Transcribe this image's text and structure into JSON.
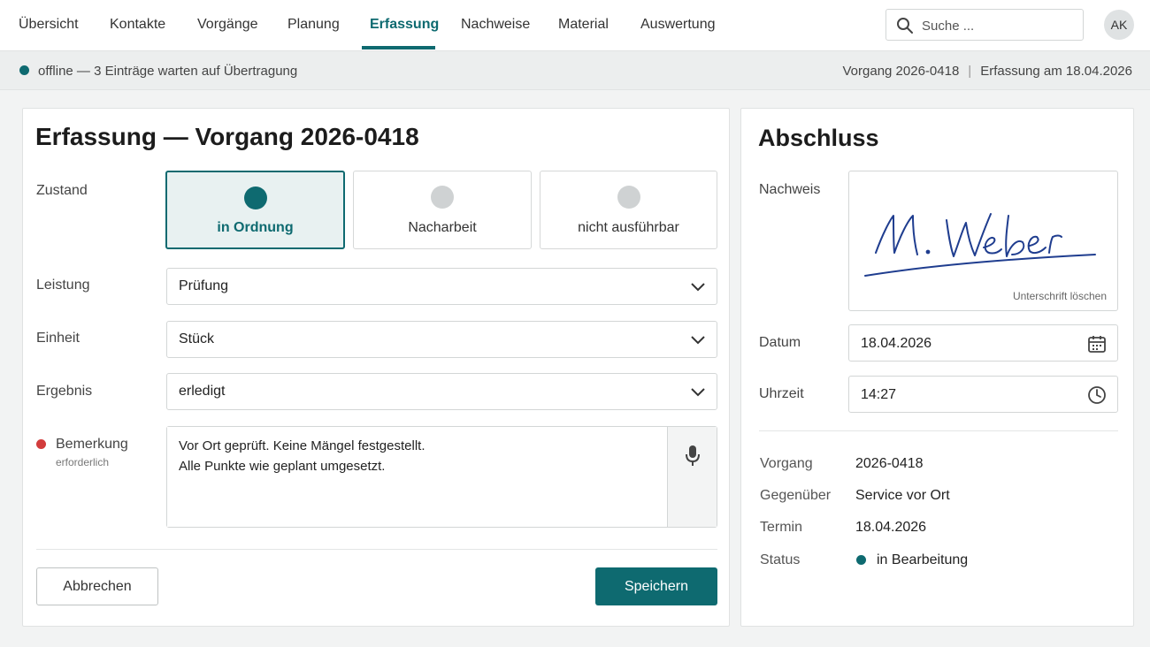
{
  "nav": {
    "tabs": [
      {
        "label": "Übersicht"
      },
      {
        "label": "Kontakte"
      },
      {
        "label": "Vorgänge"
      },
      {
        "label": "Planung"
      },
      {
        "label": "Erfassung",
        "active": true
      },
      {
        "label": "Nachweise"
      },
      {
        "label": "Material"
      },
      {
        "label": "Auswertung"
      }
    ],
    "search_placeholder": "Suche ...",
    "avatar_initials": "AK"
  },
  "status": {
    "text": "offline — 3 Einträge warten auf Übertragung",
    "vorgang": "Vorgang 2026-0418",
    "separator": "|",
    "erfassung_datum": "Erfassung am 18.04.2026",
    "dot_color": "#0e6a70"
  },
  "form": {
    "title": "Erfassung — Vorgang 2026-0418",
    "zustand_label": "Zustand",
    "zustand_options": [
      {
        "label": "in Ordnung",
        "selected": true
      },
      {
        "label": "Nacharbeit",
        "selected": false
      },
      {
        "label": "nicht ausführbar",
        "selected": false
      }
    ],
    "leistung_label": "Leistung",
    "leistung_value": "Prüfung",
    "einheit_label": "Einheit",
    "einheit_value": "Stück",
    "ergebnis_label": "Ergebnis",
    "ergebnis_value": "erledigt",
    "bemerkung_label": "Bemerkung",
    "bemerkung_required": "erforderlich",
    "bemerkung_text": "Vor Ort geprüft. Keine Mängel festgestellt.\nAlle Punkte wie geplant umgesetzt.",
    "cancel_label": "Abbrechen",
    "save_label": "Speichern"
  },
  "abschluss": {
    "title": "Abschluss",
    "nachweis_label": "Nachweis",
    "signature_name": "M. Weber",
    "signature_clear": "Unterschrift löschen",
    "datum_label": "Datum",
    "datum_value": "18.04.2026",
    "uhrzeit_label": "Uhrzeit",
    "uhrzeit_value": "14:27",
    "details": {
      "vorgang_key": "Vorgang",
      "vorgang_val": "2026-0418",
      "gegenueber_key": "Gegenüber",
      "gegenueber_val": "Service vor Ort",
      "termin_key": "Termin",
      "termin_val": "18.04.2026",
      "status_key": "Status",
      "status_val": "in Bearbeitung"
    }
  },
  "colors": {
    "accent": "#0e6a70",
    "required": "#d23c3c",
    "signature_ink": "#1f3d8f"
  },
  "icons": {
    "search": "search-icon",
    "chevron": "chevron-down-icon",
    "mic": "microphone-icon",
    "calendar": "calendar-icon",
    "clock": "clock-icon"
  }
}
